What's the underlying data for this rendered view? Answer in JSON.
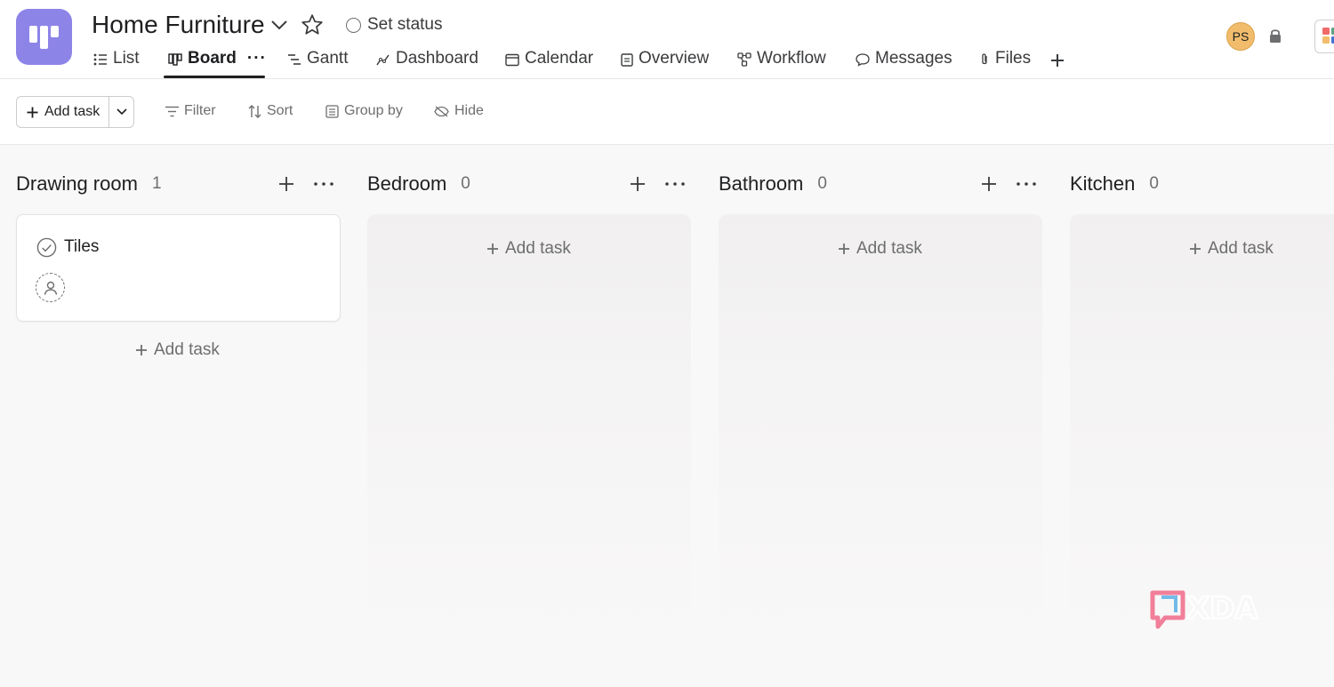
{
  "project": {
    "title": "Home Furniture",
    "set_status_label": "Set status",
    "avatar_initials": "PS",
    "icon_color": "#8d84e8"
  },
  "tabs": [
    {
      "label": "List",
      "icon": "list-icon"
    },
    {
      "label": "Board",
      "icon": "board-icon",
      "active": true
    },
    {
      "label": "Gantt",
      "icon": "gantt-icon"
    },
    {
      "label": "Dashboard",
      "icon": "dashboard-icon"
    },
    {
      "label": "Calendar",
      "icon": "calendar-icon"
    },
    {
      "label": "Overview",
      "icon": "overview-icon"
    },
    {
      "label": "Workflow",
      "icon": "workflow-icon"
    },
    {
      "label": "Messages",
      "icon": "messages-icon"
    },
    {
      "label": "Files",
      "icon": "paperclip-icon"
    }
  ],
  "toolbar": {
    "add_task_label": "Add task",
    "filter_label": "Filter",
    "sort_label": "Sort",
    "group_by_label": "Group by",
    "hide_label": "Hide"
  },
  "columns": [
    {
      "name": "Drawing room",
      "count": "1",
      "add_task_label": "Add task",
      "tasks": [
        {
          "title": "Tiles"
        }
      ]
    },
    {
      "name": "Bedroom",
      "count": "0",
      "add_task_label": "Add task",
      "tasks": []
    },
    {
      "name": "Bathroom",
      "count": "0",
      "add_task_label": "Add task",
      "tasks": []
    },
    {
      "name": "Kitchen",
      "count": "0",
      "add_task_label": "Add task",
      "tasks": []
    }
  ],
  "watermark": "XDA"
}
